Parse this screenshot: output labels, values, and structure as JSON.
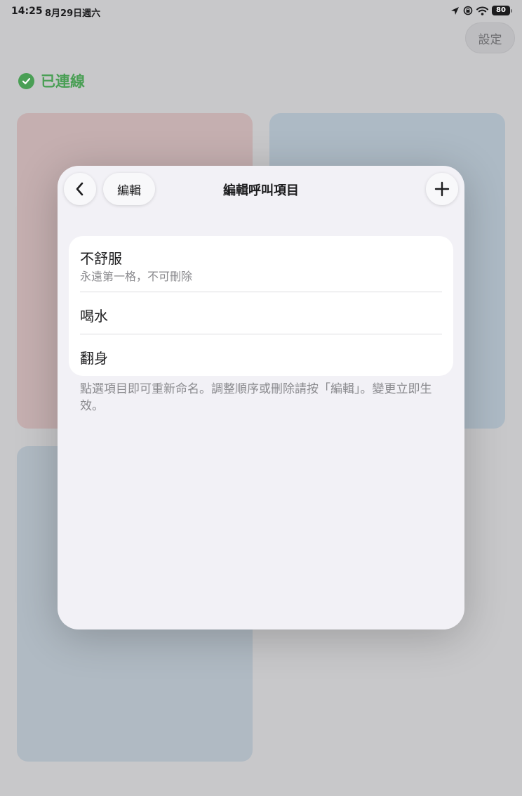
{
  "status_bar": {
    "time": "14:25",
    "date": "8月29日週六",
    "battery": "80"
  },
  "background": {
    "settings_label": "設定",
    "connection_label": "已連線",
    "colors": {
      "connected_green": "#4a9f55",
      "card_pink": "#c5afb0",
      "card_blue": "#adbac5"
    }
  },
  "modal": {
    "title": "編輯呼叫項目",
    "back_icon": "chevron-left-icon",
    "edit_label": "編輯",
    "add_icon": "plus-icon",
    "items": [
      {
        "title": "不舒服",
        "subtitle": "永遠第一格，不可刪除"
      },
      {
        "title": "喝水"
      },
      {
        "title": "翻身"
      }
    ],
    "footer_note": "點選項目即可重新命名。調整順序或刪除請按「編輯」。變更立即生效。"
  }
}
